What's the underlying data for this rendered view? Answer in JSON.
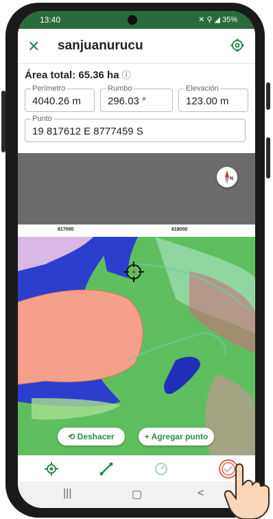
{
  "status_bar": {
    "time": "13:40",
    "battery": "35%"
  },
  "app_bar": {
    "title": "sanjuanurucu"
  },
  "area_total": {
    "label": "Área total: 65.36 ha"
  },
  "perimetro": {
    "label": "Perímetro",
    "value": "4040.26 m"
  },
  "rumbo": {
    "label": "Rumbo",
    "value": "296.03 °"
  },
  "elevacion": {
    "label": "Elevación",
    "value": "123.00 m"
  },
  "punto": {
    "label": "Punto",
    "value": "19 817612 E 8777459 S"
  },
  "compass": {
    "letter": "N"
  },
  "grid_labels": [
    "817000",
    "818000"
  ],
  "actions": {
    "undo": "⟲ Deshacer",
    "add_point": "+ Agregar punto"
  },
  "icons": [
    "close-icon",
    "settings-icon",
    "compass-icon",
    "crosshair-icon",
    "location-tool-icon",
    "line-tool-icon",
    "measure-tool-icon",
    "check-tool-icon"
  ]
}
